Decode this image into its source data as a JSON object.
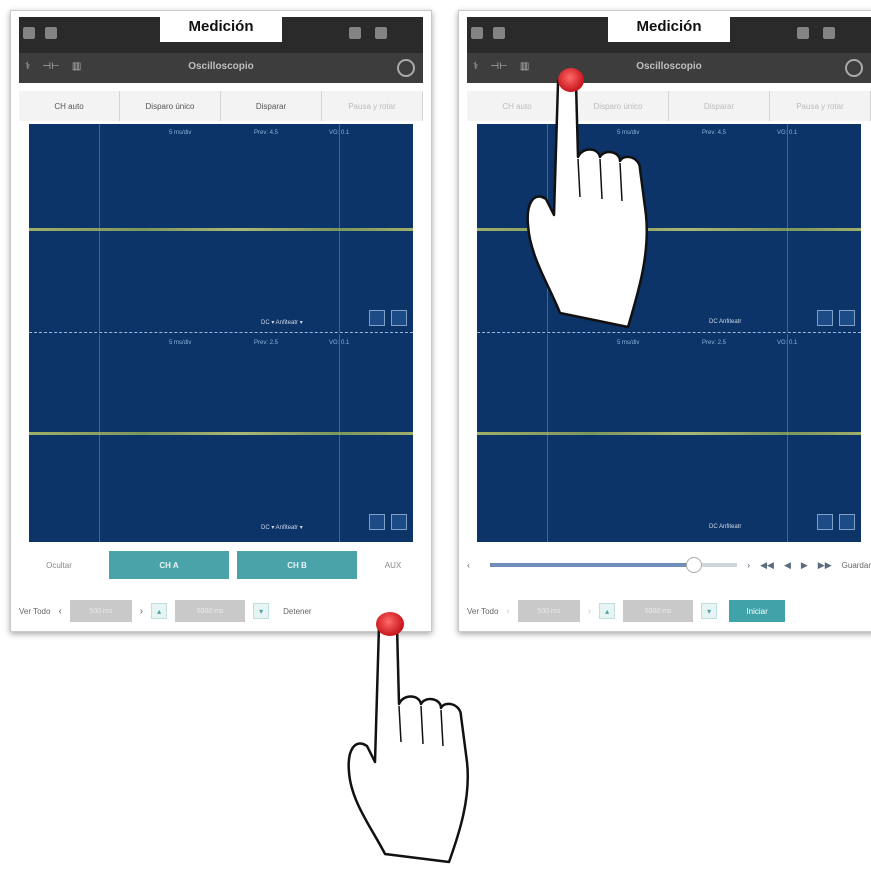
{
  "panels": [
    {
      "label": "Medición",
      "app_title": "Oscilloscopio",
      "modes": [
        "CH auto",
        "Disparo único",
        "Disparar",
        "Pausa y rotar"
      ],
      "readouts_top": [
        "5 ms/div",
        "Prev: 4.5",
        "VG: 0.1"
      ],
      "readouts_bottom": [
        "5 ms/div",
        "Prev: 2.5",
        "VG: 0.1"
      ],
      "bottom_buttons": [
        "Ocultar",
        "CH A",
        "CH B",
        "AUX"
      ],
      "time_row": {
        "label": "Ver Todo",
        "value_a": "500 ms",
        "value_b": "5000 ms",
        "action": "Detener"
      }
    },
    {
      "label": "Medición",
      "app_title": "Oscilloscopio",
      "modes": [
        "CH auto",
        "Disparo único",
        "Disparar",
        "Pausa y rotar"
      ],
      "readouts_top": [
        "5 ms/div",
        "Prev: 4.5",
        "VG: 0.1"
      ],
      "readouts_bottom": [
        "5 ms/div",
        "Prev: 2.5",
        "VG: 0.1"
      ],
      "playback_save": "Guardar",
      "playback_progress": 0.82,
      "time_row": {
        "label": "Ver Todo",
        "value_a": "500 ms",
        "value_b": "5000 ms",
        "action": "Iniciar"
      }
    }
  ],
  "colors": {
    "accent": "#4aa3a8",
    "scope_bg": "#0c3468",
    "tap": "#d0171d"
  },
  "icons": [
    "status-icon",
    "menu-icon",
    "refresh-icon",
    "play-icon",
    "rewind-icon",
    "forward-icon"
  ]
}
